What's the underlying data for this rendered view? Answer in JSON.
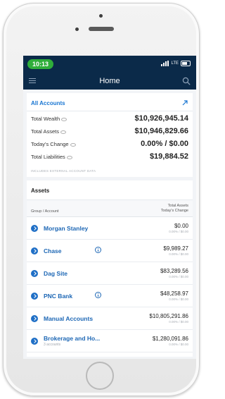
{
  "status": {
    "time": "10:13",
    "network": "LTE"
  },
  "nav": {
    "title": "Home",
    "menu_icon": "menu-icon",
    "search_icon": "search-icon"
  },
  "summary": {
    "header": "All Accounts",
    "expand_icon": "expand-arrow-icon",
    "rows": [
      {
        "label": "Total Wealth",
        "value": "$10,926,945.14"
      },
      {
        "label": "Total Assets",
        "value": "$10,946,829.66"
      },
      {
        "label": "Today's Change",
        "value": "0.00% / $0.00"
      },
      {
        "label": "Total Liabilities",
        "value": "$19,884.52"
      }
    ],
    "note": "INCLUDES EXTERNAL ACCOUNT DATA"
  },
  "assets": {
    "title": "Assets",
    "col_left": "Group / Account",
    "col_right_1": "Total Assets",
    "col_right_2": "Today's Change",
    "accounts": [
      {
        "name": "Morgan Stanley",
        "sub": "",
        "value": "$0.00",
        "change": "0.00% / $0.00",
        "info": false
      },
      {
        "name": "Chase",
        "sub": "",
        "value": "$9,989.27",
        "change": "0.00% / $0.00",
        "info": true
      },
      {
        "name": "Dag Site",
        "sub": "",
        "value": "$83,289.56",
        "change": "0.00% / $0.00",
        "info": false
      },
      {
        "name": "PNC Bank",
        "sub": "",
        "value": "$48,258.97",
        "change": "0.00% / $0.00",
        "info": true
      },
      {
        "name": "Manual Accounts",
        "sub": "",
        "value": "$10,805,291.86",
        "change": "0.00% / $0.00",
        "info": false
      },
      {
        "name": "Brokerage and Ho...",
        "sub": "3 accounts",
        "value": "$1,280,091.86",
        "change": "0.00% / $0.00",
        "info": false
      }
    ]
  },
  "colors": {
    "nav_bg": "#0b2a49",
    "accent": "#1976d2",
    "time_pill": "#2fae3a"
  }
}
